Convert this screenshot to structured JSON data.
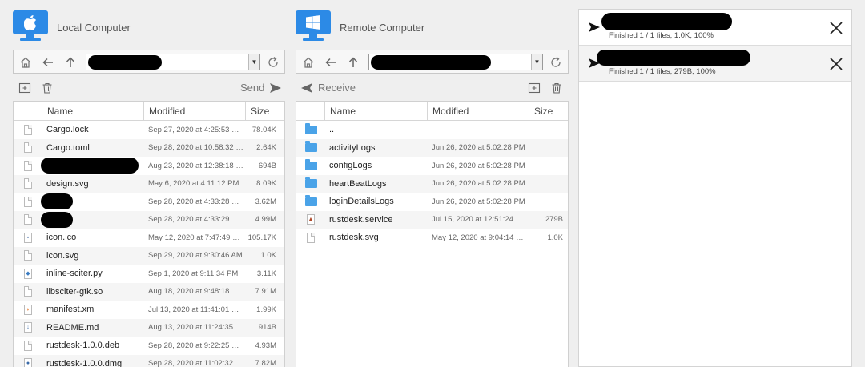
{
  "local": {
    "title": "Local Computer",
    "send_label": "Send",
    "columns": [
      "Name",
      "Modified",
      "Size"
    ],
    "files": [
      {
        "name": "Cargo.lock",
        "modified": "Sep 27, 2020 at 4:25:53 …",
        "size": "78.04K",
        "icon": "file-icon",
        "redacted": false
      },
      {
        "name": "Cargo.toml",
        "modified": "Sep 28, 2020 at 10:58:32 …",
        "size": "2.64K",
        "icon": "file-icon",
        "redacted": false
      },
      {
        "name": "",
        "modified": "Aug 23, 2020 at 12:38:18 …",
        "size": "694B",
        "icon": "file-icon",
        "redacted": true
      },
      {
        "name": "design.svg",
        "modified": "May 6, 2020 at 4:11:12 PM",
        "size": "8.09K",
        "icon": "file-icon",
        "redacted": false
      },
      {
        "name": "",
        "modified": "Sep 28, 2020 at 4:33:28 …",
        "size": "3.62M",
        "icon": "file-icon",
        "redacted": true
      },
      {
        "name": "",
        "modified": "Sep 28, 2020 at 4:33:29 …",
        "size": "4.99M",
        "icon": "file-icon",
        "redacted": true
      },
      {
        "name": "icon.ico",
        "modified": "May 12, 2020 at 7:47:49 …",
        "size": "105.17K",
        "icon": "ico-file-icon",
        "redacted": false
      },
      {
        "name": "icon.svg",
        "modified": "Sep 29, 2020 at 9:30:46 AM",
        "size": "1.0K",
        "icon": "file-icon",
        "redacted": false
      },
      {
        "name": "inline-sciter.py",
        "modified": "Sep 1, 2020 at 9:11:34 PM",
        "size": "3.11K",
        "icon": "python-file-icon",
        "redacted": false
      },
      {
        "name": "libsciter-gtk.so",
        "modified": "Aug 18, 2020 at 9:48:18 …",
        "size": "7.91M",
        "icon": "file-icon",
        "redacted": false
      },
      {
        "name": "manifest.xml",
        "modified": "Jul 13, 2020 at 11:41:01 …",
        "size": "1.99K",
        "icon": "rss-file-icon",
        "redacted": false
      },
      {
        "name": "README.md",
        "modified": "Aug 13, 2020 at 11:24:35 …",
        "size": "914B",
        "icon": "markdown-file-icon",
        "redacted": false
      },
      {
        "name": "rustdesk-1.0.0.deb",
        "modified": "Sep 28, 2020 at 9:22:25 …",
        "size": "4.93M",
        "icon": "file-icon",
        "redacted": false
      },
      {
        "name": "rustdesk-1.0.0.dmg",
        "modified": "Sep 28, 2020 at 11:02:32 …",
        "size": "7.82M",
        "icon": "disk-image-icon",
        "redacted": false
      }
    ]
  },
  "remote": {
    "title": "Remote Computer",
    "receive_label": "Receive",
    "columns": [
      "Name",
      "Modified",
      "Size"
    ],
    "files": [
      {
        "name": "..",
        "modified": "",
        "size": "",
        "icon": "folder-icon"
      },
      {
        "name": "activityLogs",
        "modified": "Jun 26, 2020 at 5:02:28 PM",
        "size": "",
        "icon": "folder-icon"
      },
      {
        "name": "configLogs",
        "modified": "Jun 26, 2020 at 5:02:28 PM",
        "size": "",
        "icon": "folder-icon"
      },
      {
        "name": "heartBeatLogs",
        "modified": "Jun 26, 2020 at 5:02:28 PM",
        "size": "",
        "icon": "folder-icon"
      },
      {
        "name": "loginDetailsLogs",
        "modified": "Jun 26, 2020 at 5:02:28 PM",
        "size": "",
        "icon": "folder-icon"
      },
      {
        "name": "rustdesk.service",
        "modified": "Jul 15, 2020 at 12:51:24 …",
        "size": "279B",
        "icon": "service-file-icon"
      },
      {
        "name": "rustdesk.svg",
        "modified": "May 12, 2020 at 9:04:14 …",
        "size": "1.0K",
        "icon": "file-icon"
      }
    ]
  },
  "transfers": [
    {
      "status": "Finished 1 / 1 files, 1.0K, 100%"
    },
    {
      "status": "Finished 1 / 1 files, 279B, 100%"
    }
  ],
  "colors": {
    "accent": "#2c8ae6",
    "folder": "#4aa3e8"
  }
}
